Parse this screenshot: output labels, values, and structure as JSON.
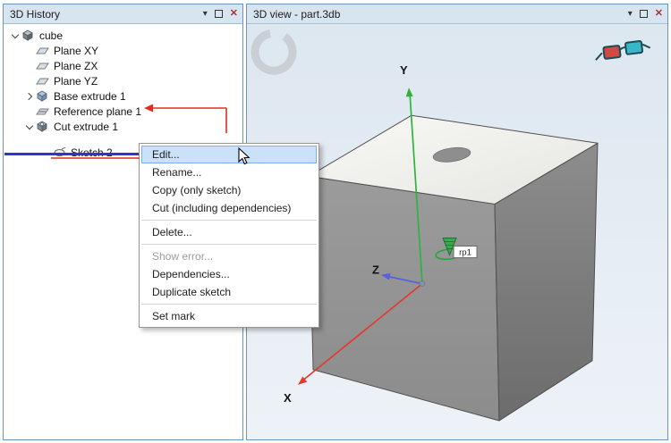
{
  "window_buttons": {
    "pin_glyph": "▾",
    "close_glyph": "✕"
  },
  "left_panel": {
    "title": "3D History",
    "tree": {
      "items": [
        {
          "label": "cube",
          "level": 0,
          "expanded": true
        },
        {
          "label": "Plane XY",
          "level": 1
        },
        {
          "label": "Plane ZX",
          "level": 1
        },
        {
          "label": "Plane YZ",
          "level": 1
        },
        {
          "label": "Base extrude 1",
          "level": 1,
          "collapsed": true
        },
        {
          "label": "Reference plane 1",
          "level": 1,
          "annotated": true
        },
        {
          "label": "Cut extrude 1",
          "level": 1,
          "expanded": true,
          "insert_marker_below": true
        },
        {
          "label": "Sketch 2",
          "level": 2,
          "annotated": true
        }
      ]
    }
  },
  "context_menu": {
    "items": [
      {
        "label": "Edit...",
        "state": "highlighted"
      },
      {
        "label": "Rename...",
        "state": "normal"
      },
      {
        "label": "Copy (only sketch)",
        "state": "normal"
      },
      {
        "label": "Cut (including dependencies)",
        "state": "normal"
      },
      {
        "label": "Delete...",
        "state": "normal"
      },
      {
        "label": "Show error...",
        "state": "disabled"
      },
      {
        "label": "Dependencies...",
        "state": "normal"
      },
      {
        "label": "Duplicate sketch",
        "state": "normal"
      },
      {
        "label": "Set mark",
        "state": "normal"
      }
    ]
  },
  "right_panel": {
    "title": "3D view - part.3db",
    "axes": {
      "x": "X",
      "y": "Y",
      "z": "Z"
    },
    "marker_label": "rp1"
  },
  "colors": {
    "titlebar_bg": "#d7e5f1",
    "panel_border": "#6d94b8",
    "menu_highlight": "#c9e2f8",
    "insert_line": "#2b35d4",
    "annotation_red": "#e32b24",
    "axis_x": "#e03b2d",
    "axis_y": "#2eb33e",
    "axis_z": "#5563d6"
  }
}
